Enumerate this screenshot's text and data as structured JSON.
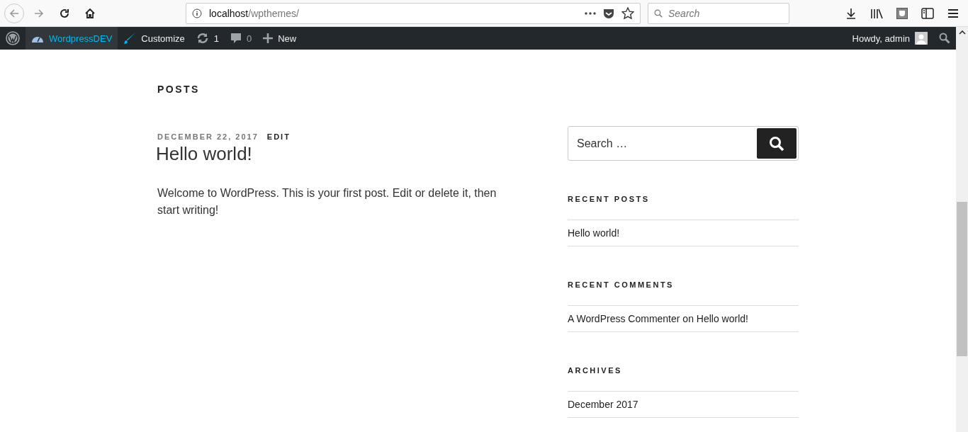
{
  "browser": {
    "url_host": "localhost",
    "url_path": "/wpthemes/",
    "search_placeholder": "Search"
  },
  "admin_bar": {
    "site": "WordpressDEV",
    "customize": "Customize",
    "updates": "1",
    "comments": "0",
    "new": "New",
    "howdy": "Howdy, admin"
  },
  "page_title": "POSTS",
  "post": {
    "date": "DECEMBER 22, 2017",
    "edit": "EDIT",
    "title": "Hello world!",
    "body": "Welcome to WordPress. This is your first post. Edit or delete it, then start writing!"
  },
  "sidebar": {
    "search_placeholder": "Search …",
    "widgets": [
      {
        "kind": "links",
        "title": "RECENT POSTS",
        "items": [
          "Hello world!"
        ]
      },
      {
        "kind": "comments",
        "title": "RECENT COMMENTS",
        "items": [
          {
            "author": "A WordPress Commenter",
            "joiner": "on",
            "post": "Hello world!"
          }
        ]
      },
      {
        "kind": "links",
        "title": "ARCHIVES",
        "items": [
          "December 2017"
        ]
      }
    ]
  }
}
